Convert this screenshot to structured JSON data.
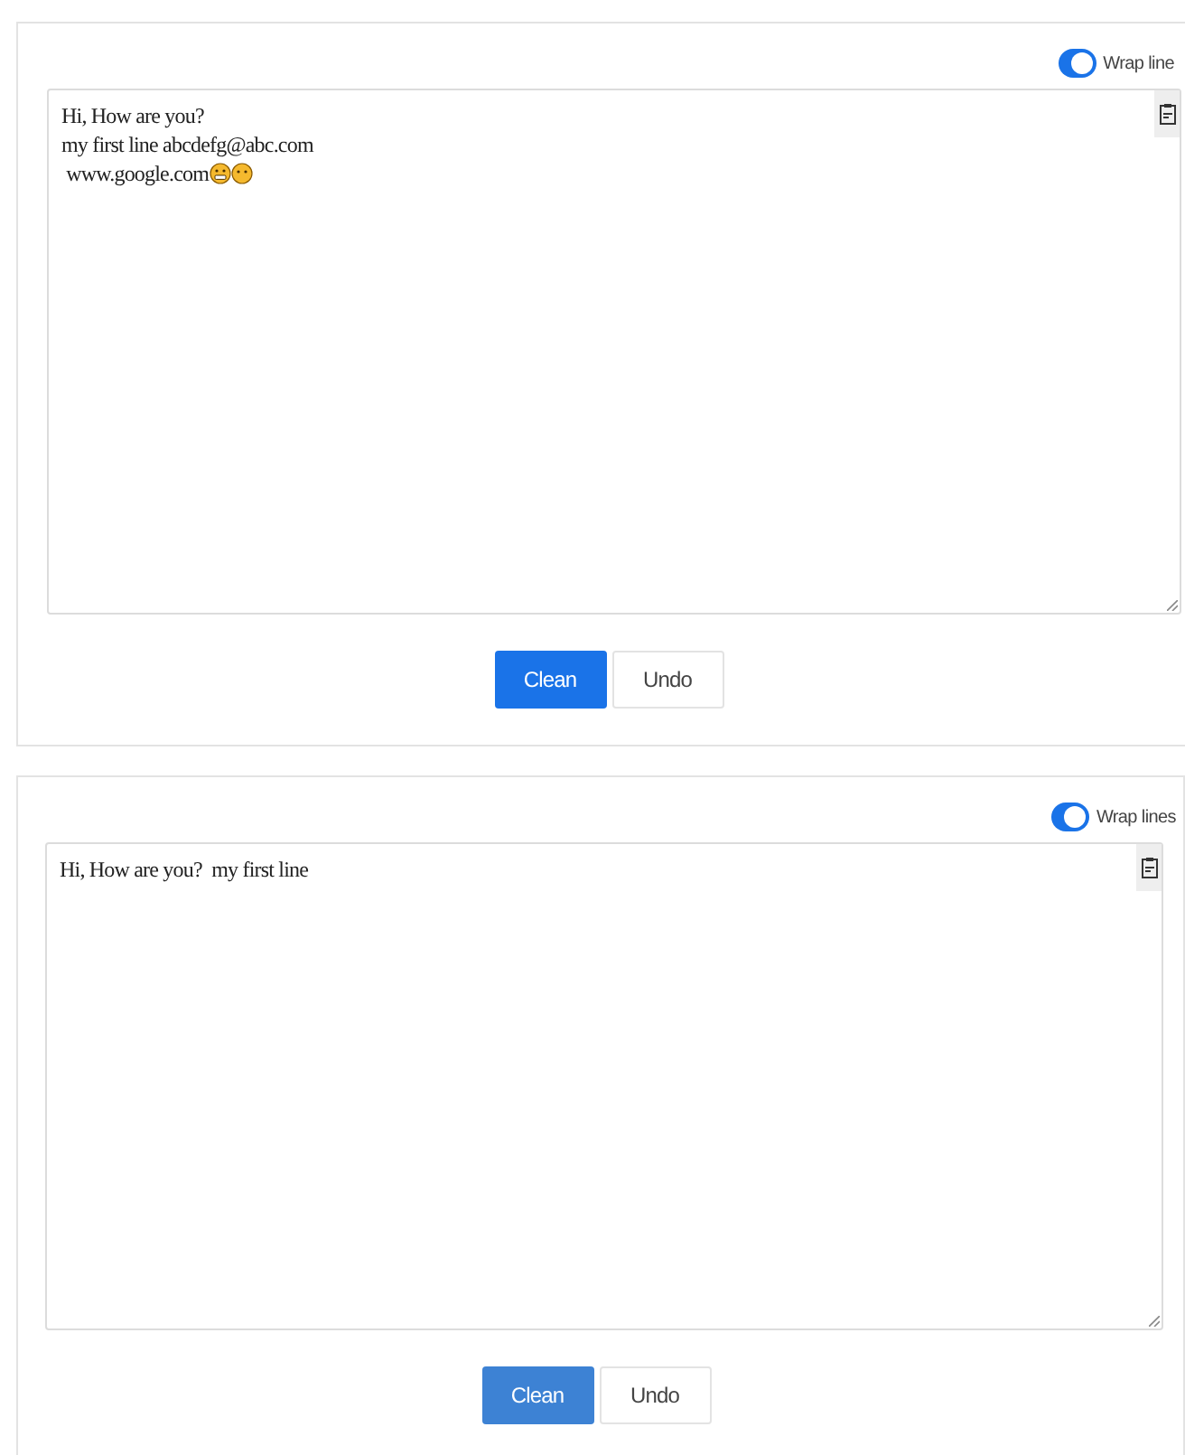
{
  "panels": [
    {
      "wrap_toggle": {
        "label": "Wrap line",
        "on": true
      },
      "lines": [
        {
          "text": "Hi, How are you?"
        },
        {
          "text": "my first line abcdefg@abc.com"
        },
        {
          "text": " www.google.com",
          "icons": [
            {
              "kind": "grimace"
            },
            {
              "kind": "blank"
            }
          ]
        }
      ],
      "buttons": [
        {
          "label": "Clean",
          "kind": "primary",
          "dimmed": false
        },
        {
          "label": "Undo",
          "kind": "secondary",
          "dimmed": false
        }
      ]
    },
    {
      "wrap_toggle": {
        "label": "Wrap lines",
        "on": true
      },
      "lines": [
        {
          "text": "Hi, How are you?  my first line"
        }
      ],
      "buttons": [
        {
          "label": "Clean",
          "kind": "primary",
          "dimmed": true
        },
        {
          "label": "Undo",
          "kind": "secondary",
          "dimmed": false
        }
      ]
    }
  ]
}
